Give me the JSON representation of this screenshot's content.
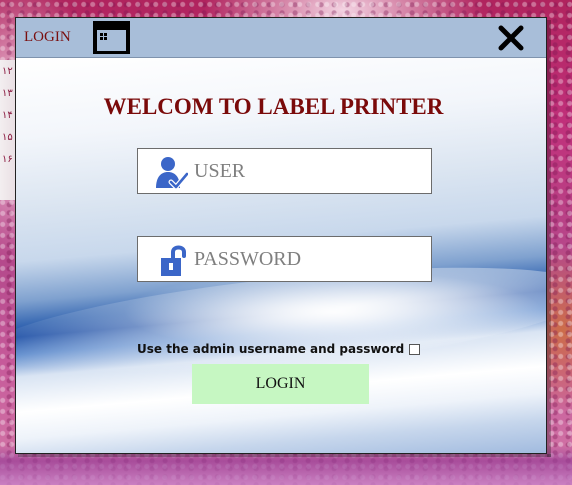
{
  "window": {
    "title": "LOGIN",
    "title_icon": "grid-window-icon",
    "close_icon": "close-icon"
  },
  "main": {
    "heading": "WELCOM TO LABEL PRINTER",
    "user_field": {
      "placeholder": "USER",
      "value": "",
      "icon": "user-check-icon"
    },
    "password_field": {
      "placeholder": "PASSWORD",
      "value": "",
      "icon": "padlock-open-icon"
    },
    "admin_hint": "Use the admin username and password",
    "admin_checked": false,
    "login_button": "LOGIN"
  },
  "colors": {
    "titlebar": "#a8bed9",
    "title_text": "#7a0f0f",
    "heading": "#7a0a0a",
    "login_button": "#c6f7c2",
    "icon_blue": "#3b66c8"
  }
}
